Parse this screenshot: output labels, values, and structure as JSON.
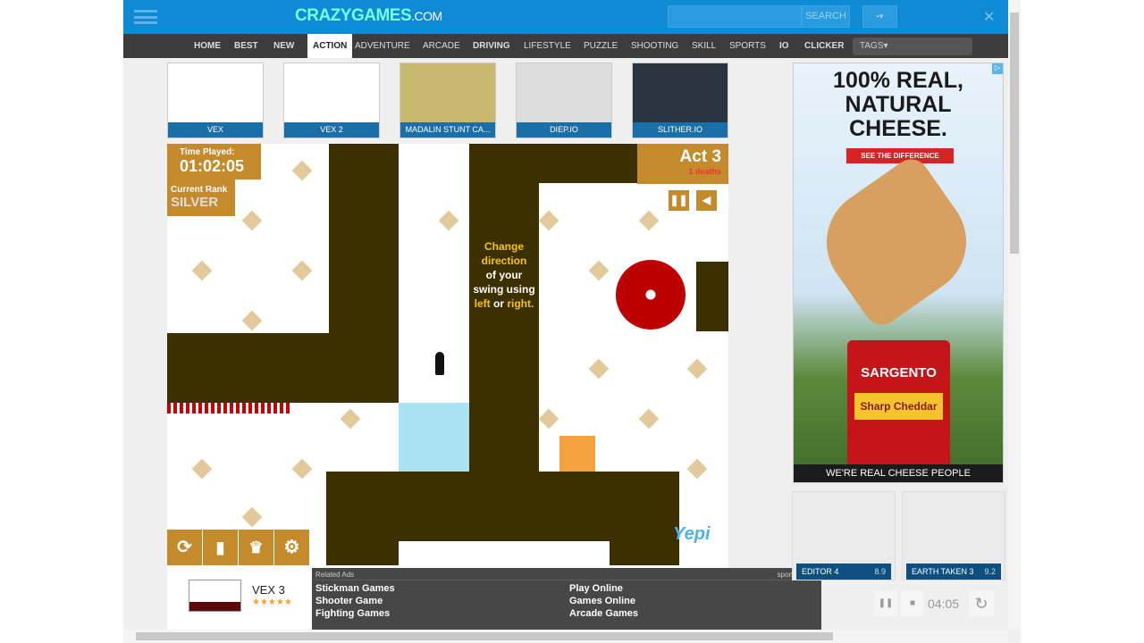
{
  "header": {
    "logo": "CRAZYGAMES",
    "logo_suffix": ".COM",
    "search_placeholder": "",
    "search_button": "SEARCH",
    "close": "✕"
  },
  "nav": [
    {
      "label": "HOME"
    },
    {
      "label": "BEST"
    },
    {
      "label": "NEW"
    },
    {
      "label": "ACTION",
      "active": true
    },
    {
      "label": "ADVENTURE"
    },
    {
      "label": "ARCADE"
    },
    {
      "label": "DRIVING"
    },
    {
      "label": "LIFESTYLE"
    },
    {
      "label": "PUZZLE"
    },
    {
      "label": "SHOOTING"
    },
    {
      "label": "SKILL"
    },
    {
      "label": "SPORTS"
    },
    {
      "label": "IO"
    },
    {
      "label": "CLICKER"
    }
  ],
  "tags_label": "TAGS",
  "thumbnails": [
    {
      "label": "VEX"
    },
    {
      "label": "VEX 2"
    },
    {
      "label": "MADALIN STUNT CA..."
    },
    {
      "label": "DIEP.IO"
    },
    {
      "label": "SLITHER.IO"
    }
  ],
  "game": {
    "time_label": "Time Played:",
    "time": "01:02:05",
    "rank_label": "Current Rank",
    "rank": "SILVER",
    "act": "Act 3",
    "deaths": "1 deaths",
    "hint": [
      "Change",
      "direction",
      "of your",
      "swing using",
      "left",
      "or",
      "right."
    ],
    "brand": "Yepi"
  },
  "game_info": {
    "title": "VEX 3",
    "rating": "★★★★★"
  },
  "ad": {
    "line1": "100% REAL,",
    "line2": "NATURAL",
    "line3": "CHEESE.",
    "cta": "SEE THE DIFFERENCE",
    "brand": "SARGENTO",
    "product": "Sharp Cheddar",
    "footer": "WE'RE REAL CHEESE PEOPLE"
  },
  "tiles": [
    {
      "label": "EDITOR 4",
      "score": "8.9"
    },
    {
      "label": "EARTH TAKEN 3",
      "score": "9.2"
    }
  ],
  "related": {
    "title": "Related Ads",
    "sponsored": "sponsored",
    "links": [
      "Stickman Games",
      "Shooter Game",
      "Fighting Games",
      "Play Online",
      "Games Online",
      "Arcade Games"
    ]
  },
  "timer": {
    "value": "04:05"
  },
  "colors": {
    "header": "#0f8ad4",
    "nav": "#3c3c3c",
    "wall": "#3d3000",
    "gold": "#c48a2c"
  }
}
